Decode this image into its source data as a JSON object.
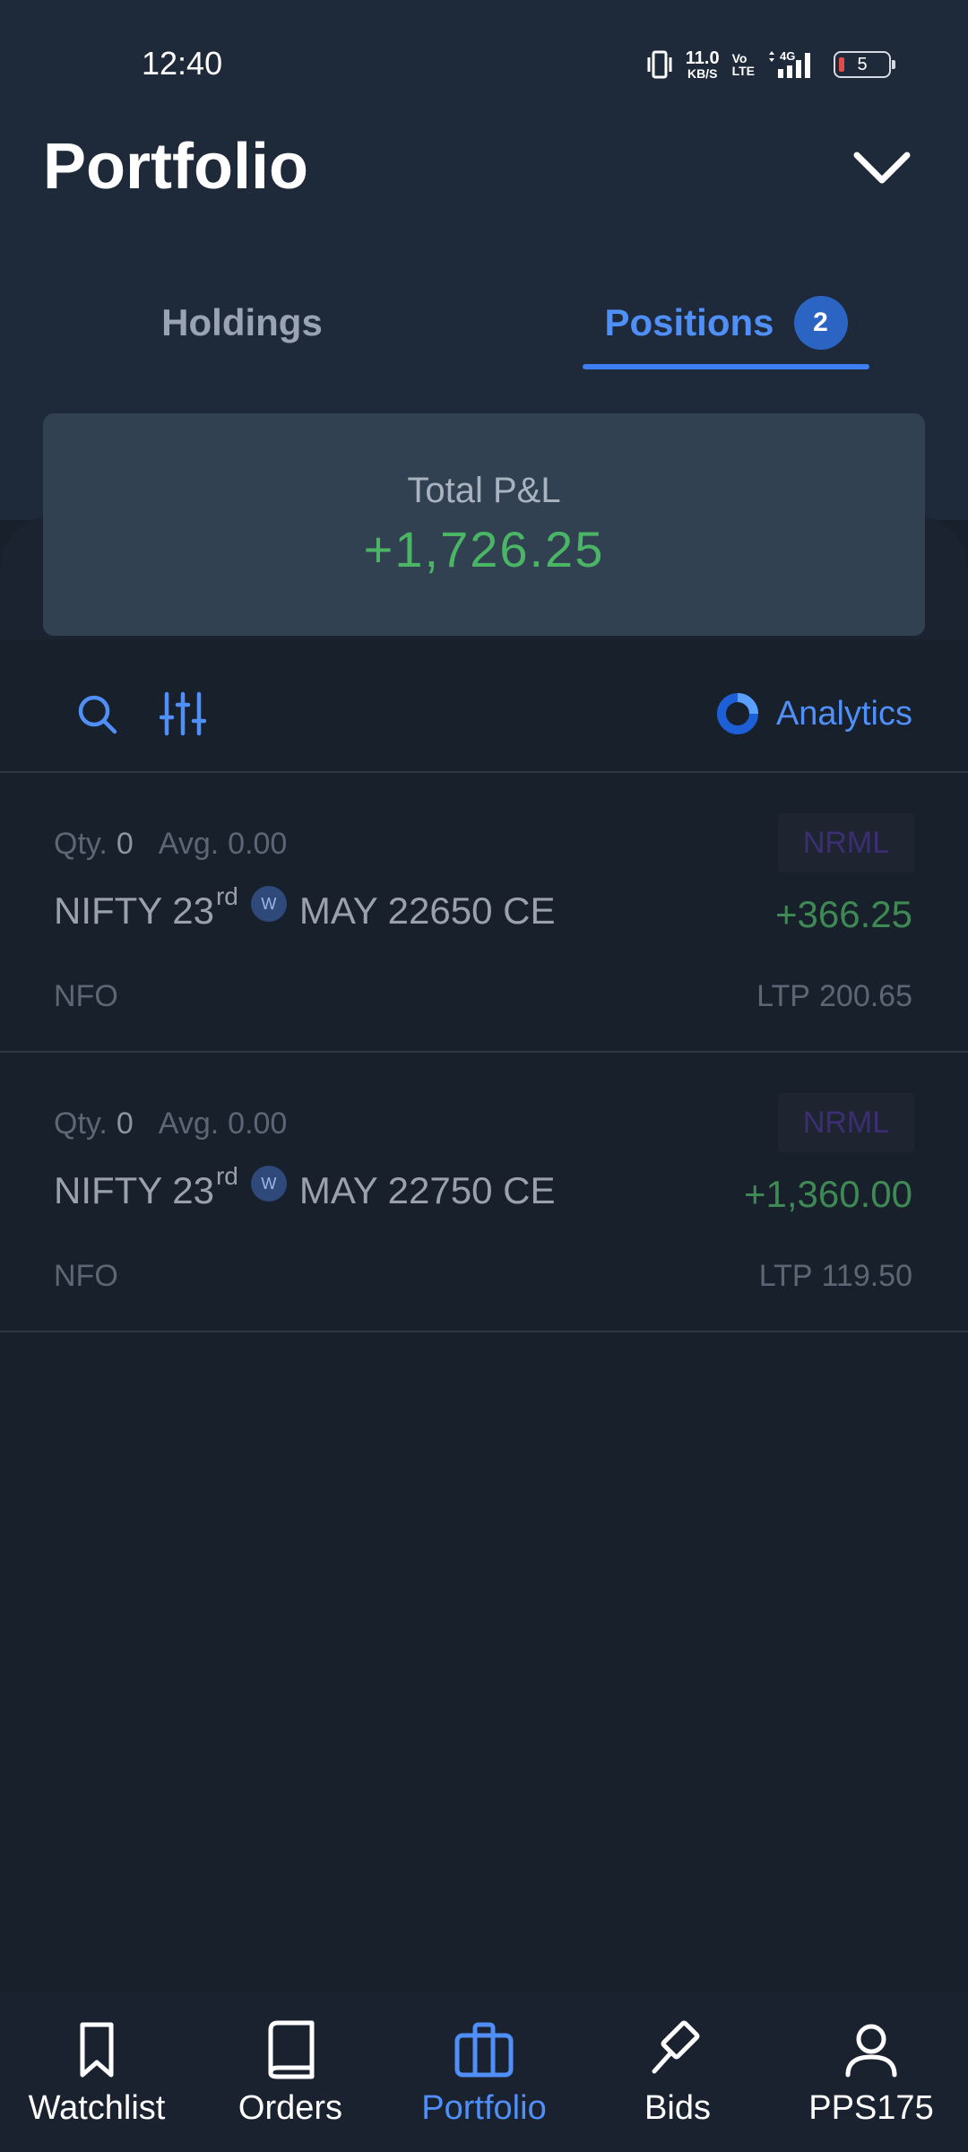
{
  "status_bar": {
    "time": "12:40",
    "net_speed_value": "11.0",
    "net_speed_unit": "KB/S",
    "volte_top": "Vo",
    "volte_bottom": "LTE",
    "network": "4G",
    "battery": "5"
  },
  "header": {
    "title": "Portfolio"
  },
  "tabs": [
    {
      "label": "Holdings",
      "active": false
    },
    {
      "label": "Positions",
      "badge": "2",
      "active": true
    }
  ],
  "summary": {
    "label": "Total P&L",
    "value": "+1,726.25"
  },
  "toolbar": {
    "analytics_label": "Analytics"
  },
  "positions": [
    {
      "qty_label": "Qty.",
      "qty": "0",
      "avg_label": "Avg.",
      "avg": "0.00",
      "product": "NRML",
      "symbol_prefix": "NIFTY 23",
      "symbol_suffix": "rd",
      "weekly_badge": "W",
      "symbol_rest": "MAY 22650 CE",
      "pnl": "+366.25",
      "exchange": "NFO",
      "ltp_label": "LTP",
      "ltp": "200.65"
    },
    {
      "qty_label": "Qty.",
      "qty": "0",
      "avg_label": "Avg.",
      "avg": "0.00",
      "product": "NRML",
      "symbol_prefix": "NIFTY 23",
      "symbol_suffix": "rd",
      "weekly_badge": "W",
      "symbol_rest": "MAY 22750 CE",
      "pnl": "+1,360.00",
      "exchange": "NFO",
      "ltp_label": "LTP",
      "ltp": "119.50"
    }
  ],
  "bottom_nav": [
    {
      "label": "Watchlist",
      "icon": "bookmark-icon"
    },
    {
      "label": "Orders",
      "icon": "book-icon"
    },
    {
      "label": "Portfolio",
      "icon": "briefcase-icon",
      "active": true
    },
    {
      "label": "Bids",
      "icon": "gavel-icon"
    },
    {
      "label": "PPS175",
      "icon": "user-icon"
    }
  ],
  "colors": {
    "accent": "#4f8ff7",
    "profit": "#4ab565",
    "background": "#18202b",
    "header_bg": "#1e2a39",
    "card_bg": "#314152"
  }
}
